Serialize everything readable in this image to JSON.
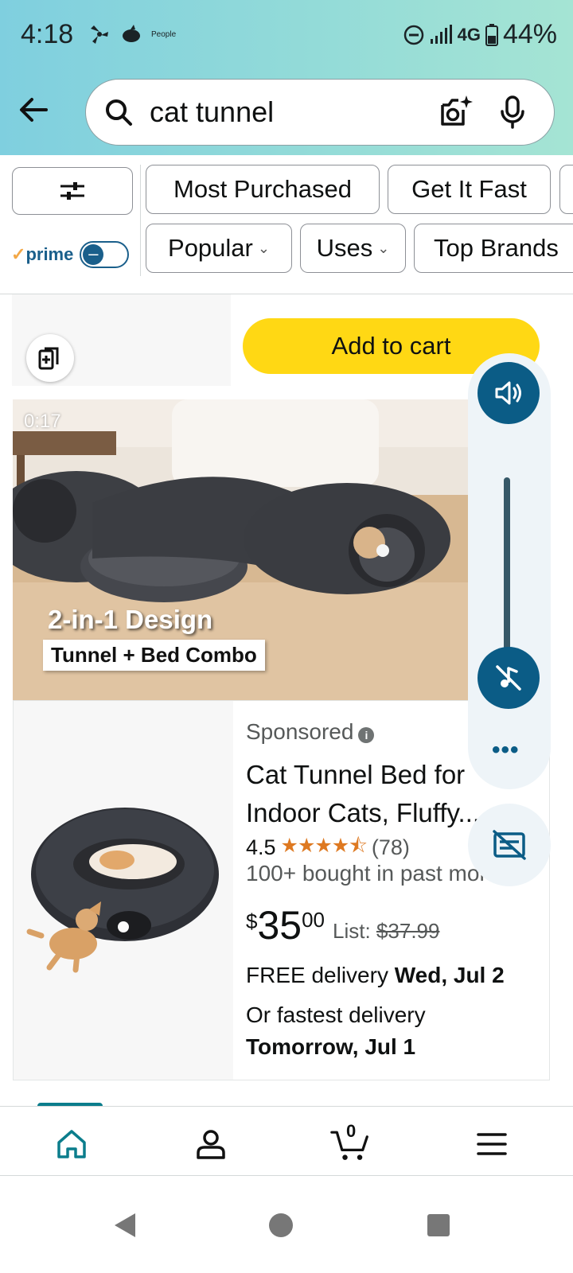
{
  "status_bar": {
    "time": "4:18",
    "left_label": "People",
    "network": "4G",
    "battery": "44%"
  },
  "search": {
    "query": "cat tunnel"
  },
  "filters": {
    "row1": [
      "Most Purchased",
      "Get It Fast"
    ],
    "row2": [
      "Popular",
      "Uses",
      "Top Brands"
    ],
    "prime_label": "prime"
  },
  "previous_card": {
    "add_to_cart": "Add to cart"
  },
  "video": {
    "timestamp": "0:17",
    "headline": "2-in-1 Design",
    "subheadline": "Tunnel + Bed Combo"
  },
  "product": {
    "sponsored": "Sponsored",
    "title": "Cat Tunnel Bed for Indoor Cats, Fluffy...",
    "rating": "4.5",
    "rating_value": 4.5,
    "reviews": "(78)",
    "bought": "100+ bought in past month",
    "price_currency": "$",
    "price_whole": "35",
    "price_cents": "00",
    "list_label": "List:",
    "list_price": "$37.99",
    "delivery_prefix": "FREE delivery",
    "delivery_date": "Wed, Jul 2",
    "fast_prefix": "Or fastest delivery",
    "fast_date": "Tomorrow, Jul 1"
  },
  "media_controls": {
    "more": "•••"
  },
  "bottom_nav": {
    "cart_count": "0"
  },
  "colors": {
    "accent": "#0b5c86",
    "add_to_cart": "#ffd814",
    "star": "#de7921",
    "prime": "#1a5f8b"
  }
}
